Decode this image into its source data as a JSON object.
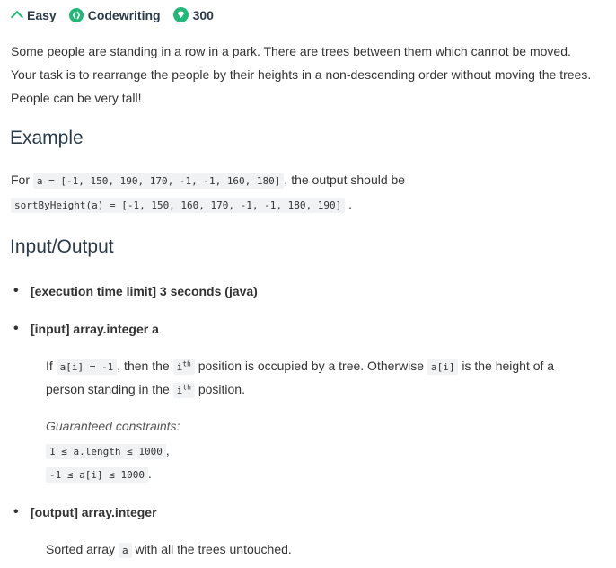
{
  "meta": {
    "difficulty": "Easy",
    "category": "Codewriting",
    "points": "300",
    "accent_color": "#20b978"
  },
  "description": {
    "line1": "Some people are standing in a row in a park. There are trees between them which cannot be moved.",
    "line2": "Your task is to rearrange the people by their heights in a non-descending order without moving the trees.",
    "line3": "People can be very tall!"
  },
  "example": {
    "heading": "Example",
    "for_text": "For",
    "input_code": "a = [-1, 150, 190, 170, -1, -1, 160, 180]",
    "output_text": ", the output should be",
    "output_code": "sortByHeight(a) = [-1, 150, 160, 170, -1, -1, 180, 190]",
    "end": "."
  },
  "io": {
    "heading": "Input/Output",
    "time_limit": "[execution time limit] 3 seconds (java)",
    "input_label": "[input] array.integer a",
    "input_desc": {
      "if": "If",
      "code1": "a[i] = -1",
      "then": ", then the",
      "ith1": "i",
      "sup1": "th",
      "occ": "position is occupied by a tree. Otherwise",
      "code2": "a[i]",
      "height": "is the height of a",
      "line2a": "person standing in the",
      "ith2": "i",
      "sup2": "th",
      "line2b": "position."
    },
    "constraints_label": "Guaranteed constraints:",
    "constraint1": "1 ≤ a.length ≤ 1000",
    "constraint1_end": ",",
    "constraint2": "-1 ≤ a[i] ≤ 1000",
    "constraint2_end": ".",
    "output_label": "[output] array.integer",
    "output_desc_a": "Sorted array",
    "output_code": "a",
    "output_desc_b": "with all the trees untouched."
  }
}
